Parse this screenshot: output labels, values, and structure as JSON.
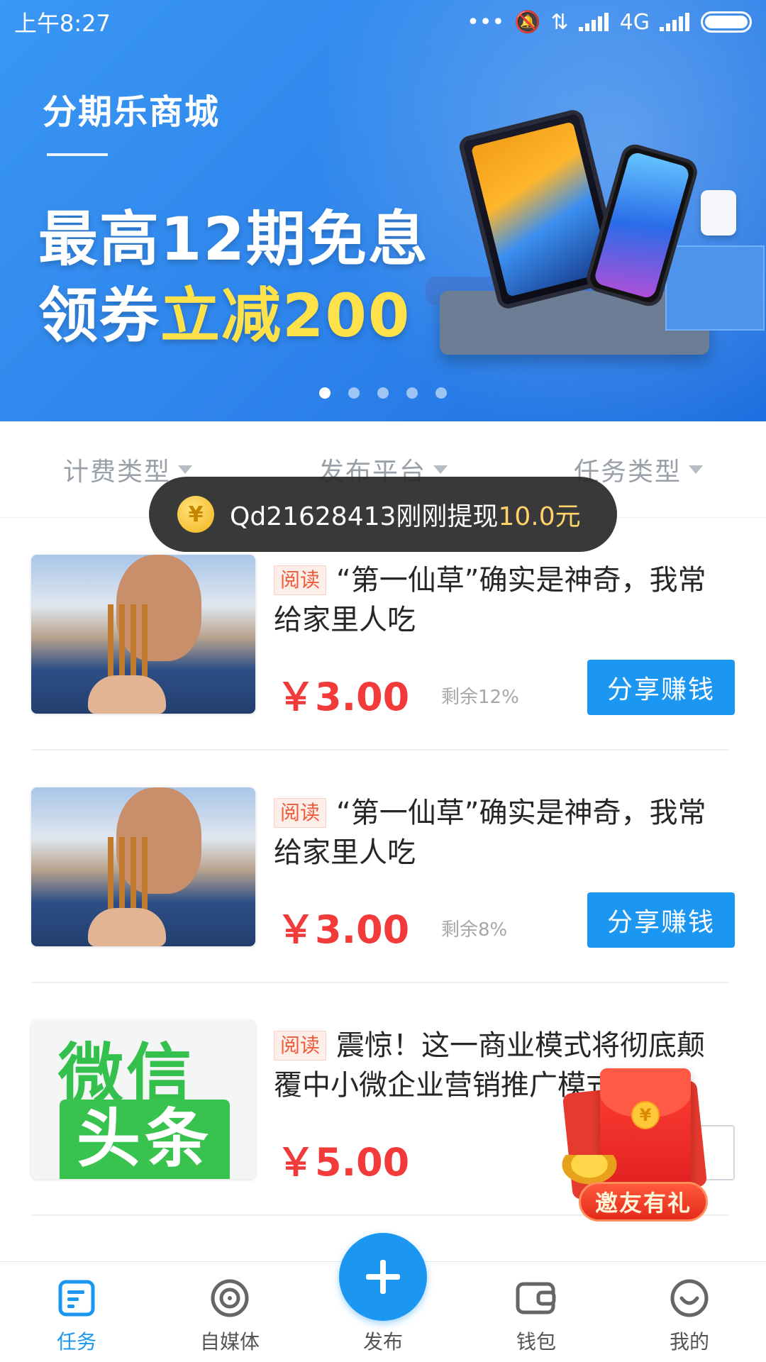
{
  "status_bar": {
    "time": "上午8:27",
    "network": "4G"
  },
  "banner": {
    "brand": "分期乐商城",
    "headline_line1": "最高12期免息",
    "headline_line2_prefix": "领券",
    "headline_line2_highlight": "立减200",
    "page_count": 5,
    "active_page": 0,
    "colors": {
      "background": "#2d83eb",
      "highlight": "#ffe14a"
    }
  },
  "filters": [
    {
      "label": "计费类型"
    },
    {
      "label": "发布平台"
    },
    {
      "label": "任务类型"
    }
  ],
  "toast": {
    "coin_symbol": "¥",
    "message": "Qd21628413刚刚提现",
    "amount": "10.0元"
  },
  "tasks": [
    {
      "tag": "阅读",
      "title": "“第一仙草”确实是神奇，我常给家里人吃",
      "price": "￥3.00",
      "remaining": "剩余12%",
      "button": "分享赚钱",
      "thumbnail": "photo"
    },
    {
      "tag": "阅读",
      "title": "“第一仙草”确实是神奇，我常给家里人吃",
      "price": "￥3.00",
      "remaining": "剩余8%",
      "button": "分享赚钱",
      "thumbnail": "photo"
    },
    {
      "tag": "阅读",
      "title": "震惊！这一商业模式将彻底颠覆中小微企业营销推广模式！",
      "price": "￥5.00",
      "remaining": "",
      "button": "",
      "thumbnail": "wechat",
      "thumbnail_text_top": "微信",
      "thumbnail_text_bottom": "头条"
    }
  ],
  "red_packet": {
    "label": "邀友有礼",
    "coin_symbol": "¥"
  },
  "bottom_nav": {
    "items": [
      {
        "label": "任务",
        "icon": "task-icon",
        "active": true
      },
      {
        "label": "自媒体",
        "icon": "target-icon",
        "active": false
      },
      {
        "label": "发布",
        "icon": "plus-icon",
        "active": false
      },
      {
        "label": "钱包",
        "icon": "wallet-icon",
        "active": false
      },
      {
        "label": "我的",
        "icon": "smile-icon",
        "active": false
      }
    ],
    "accent": "#1c97f1"
  }
}
